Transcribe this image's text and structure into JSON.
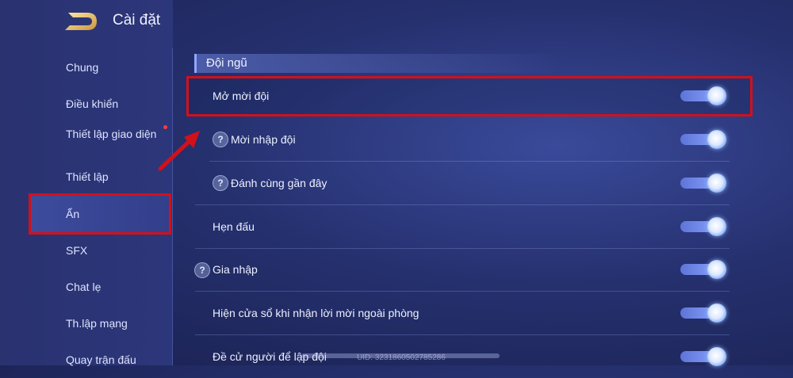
{
  "header": {
    "title": "Cài đặt"
  },
  "sidebar": {
    "items": [
      {
        "label": "Chung"
      },
      {
        "label": "Điều khiển"
      },
      {
        "label": "Thiết lập giao diện"
      },
      {
        "label": "Thiết lập"
      },
      {
        "label": "Ẩn"
      },
      {
        "label": "SFX"
      },
      {
        "label": "Chat lẹ"
      },
      {
        "label": "Th.lập mạng"
      },
      {
        "label": "Quay trận đấu"
      }
    ],
    "active_index": 4
  },
  "section": {
    "title": "Đội ngũ"
  },
  "settings": [
    {
      "label": "Mở mời đội",
      "enabled": true,
      "help": false
    },
    {
      "label": "Mời nhập đội",
      "enabled": true,
      "help": true
    },
    {
      "label": "Đánh cùng gần đây",
      "enabled": true,
      "help": true
    },
    {
      "label": "Hẹn đấu",
      "enabled": true,
      "help": false
    },
    {
      "label": "Gia nhập",
      "enabled": true,
      "help": true
    },
    {
      "label": "Hiện cửa sổ khi nhận lời mời ngoài phòng",
      "enabled": true,
      "help": false
    },
    {
      "label": "Đề cử người để lập đội",
      "enabled": true,
      "help": false
    }
  ],
  "footer": {
    "uid": "UID: 3231860502785286"
  },
  "colors": {
    "highlight": "#d3101a",
    "accent": "#8aa5ff"
  }
}
